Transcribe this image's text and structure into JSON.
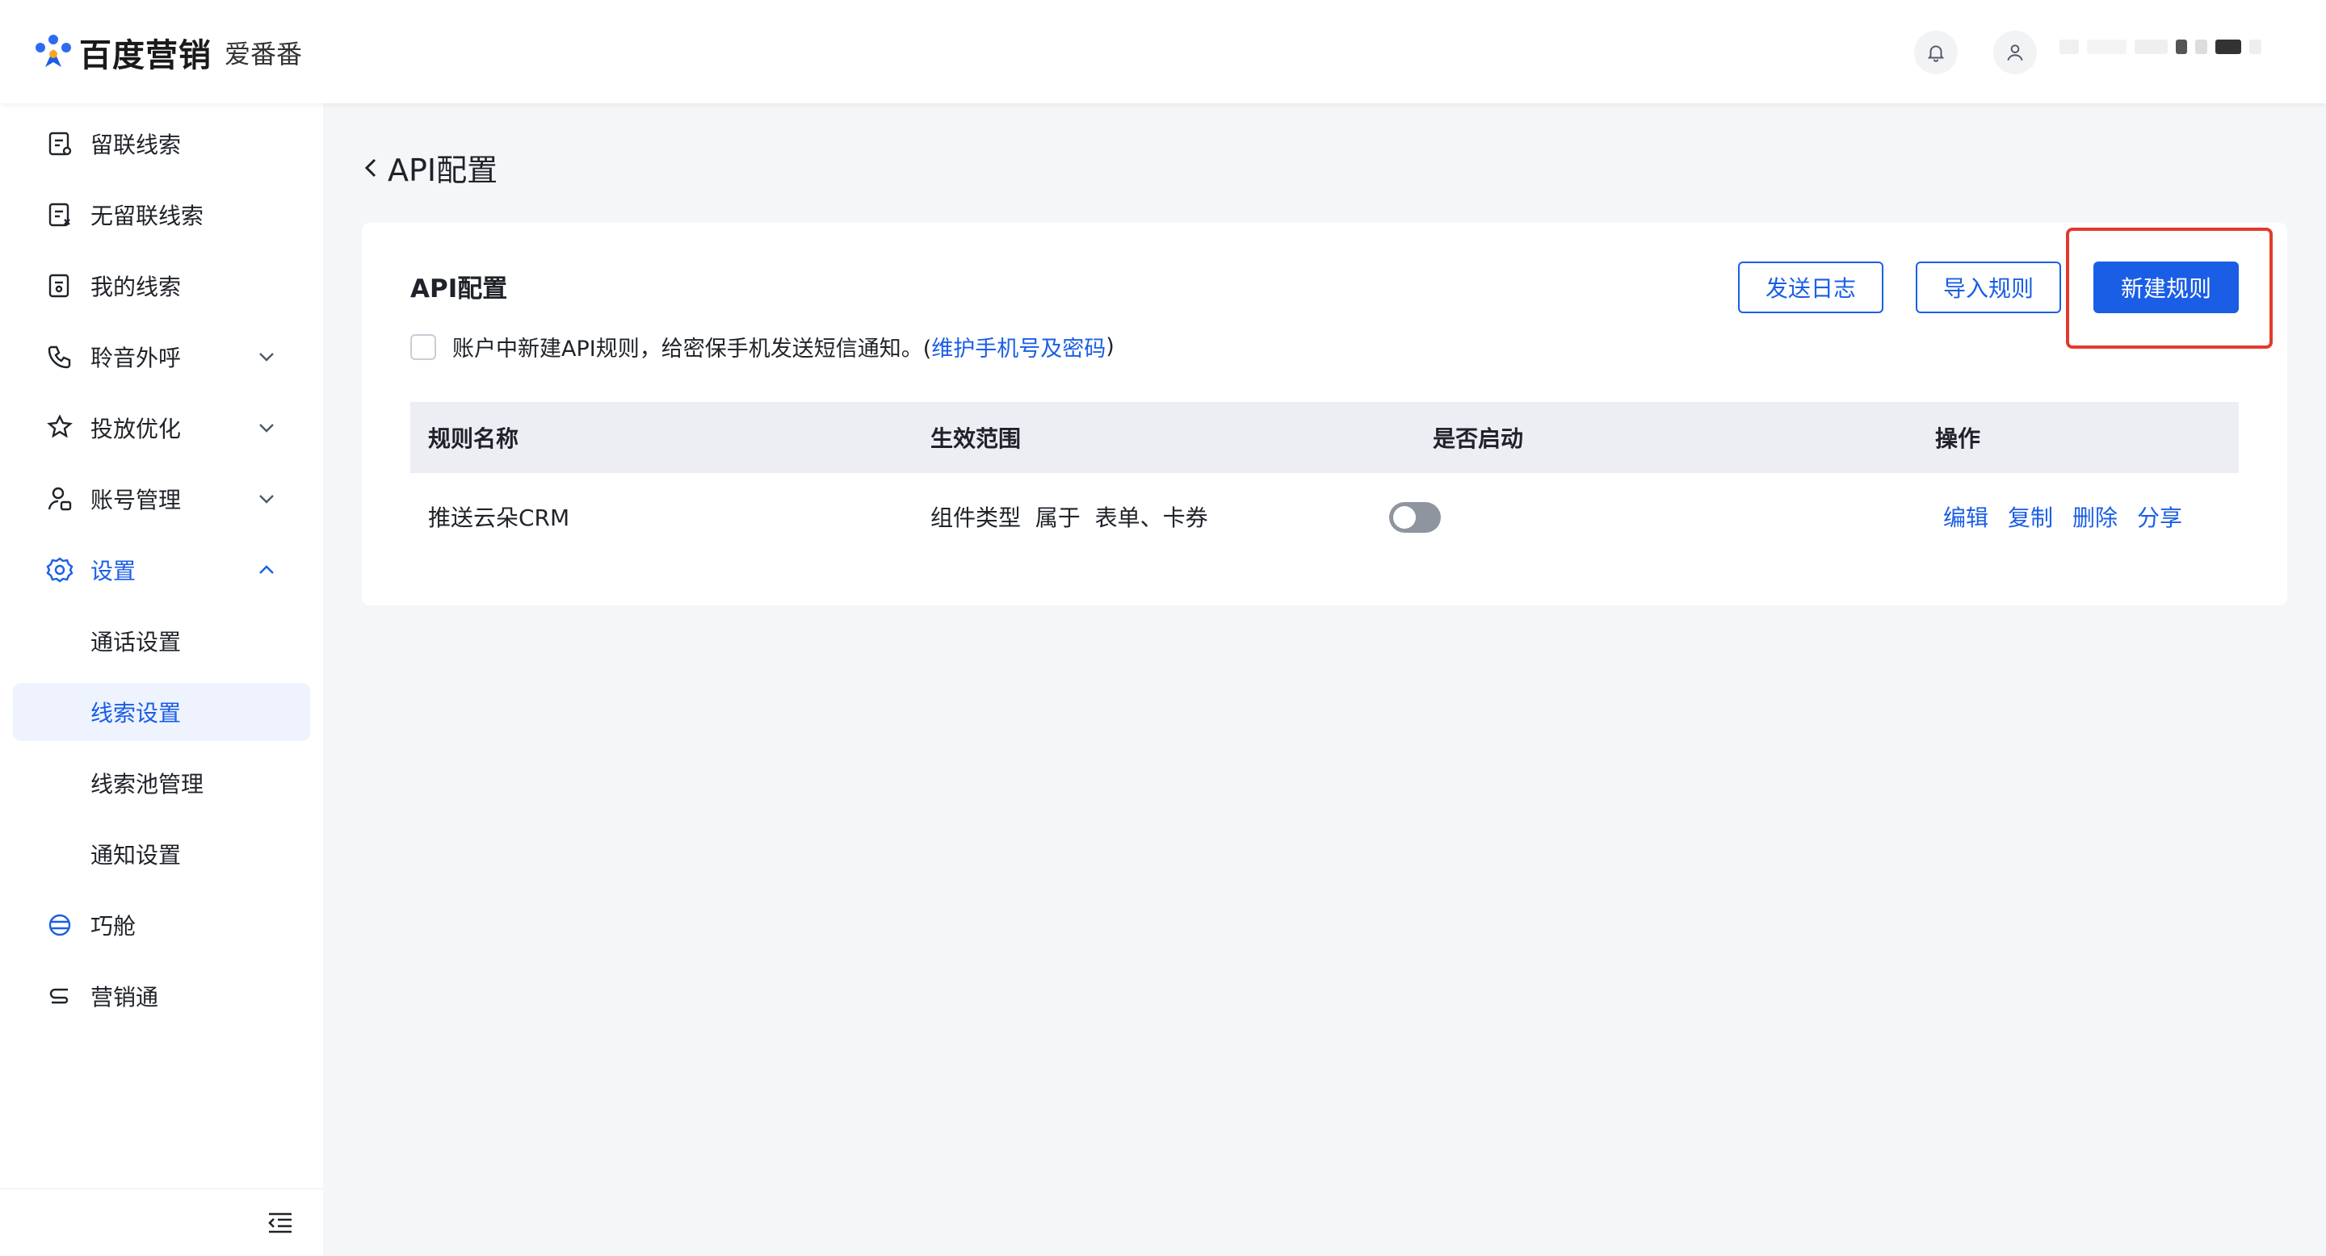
{
  "header": {
    "brand": "百度营销",
    "product": "爱番番",
    "icons": [
      "bell-icon",
      "user-icon"
    ]
  },
  "sidebar": {
    "items": [
      {
        "label": "留联线索",
        "icon": "clue-icon"
      },
      {
        "label": "无留联线索",
        "icon": "clue-x-icon"
      },
      {
        "label": "我的线索",
        "icon": "my-clue-icon"
      },
      {
        "label": "聆音外呼",
        "icon": "phone-icon",
        "expandable": true
      },
      {
        "label": "投放优化",
        "icon": "optimize-icon",
        "expandable": true
      },
      {
        "label": "账号管理",
        "icon": "account-icon",
        "expandable": true
      },
      {
        "label": "设置",
        "icon": "gear-icon",
        "expandable": true,
        "expanded": true
      },
      {
        "label": "通话设置"
      },
      {
        "label": "线索设置",
        "active": true
      },
      {
        "label": "线索池管理"
      },
      {
        "label": "通知设置"
      },
      {
        "label": "巧舱",
        "icon": "qiaocang-icon"
      },
      {
        "label": "营销通",
        "icon": "marketing-icon"
      }
    ]
  },
  "page": {
    "title": "API配置"
  },
  "card": {
    "title": "API配置",
    "notify_text": "账户中新建API规则，给密保手机发送短信通知。(",
    "notify_link": "维护手机号及密码",
    "notify_close": ")",
    "notify_checked": false,
    "buttons": {
      "send_log": "发送日志",
      "import_rule": "导入规则",
      "new_rule": "新建规则"
    }
  },
  "table": {
    "columns": [
      "规则名称",
      "生效范围",
      "是否启动",
      "操作"
    ],
    "rows": [
      {
        "name": "推送云朵CRM",
        "scope": "组件类型  属于  表单、卡券",
        "enabled": false,
        "actions": [
          "编辑",
          "复制",
          "删除",
          "分享"
        ]
      }
    ]
  },
  "colors": {
    "accent": "#1a5ee6",
    "highlight": "#e23a2e",
    "toggle_off": "#8f959e"
  }
}
